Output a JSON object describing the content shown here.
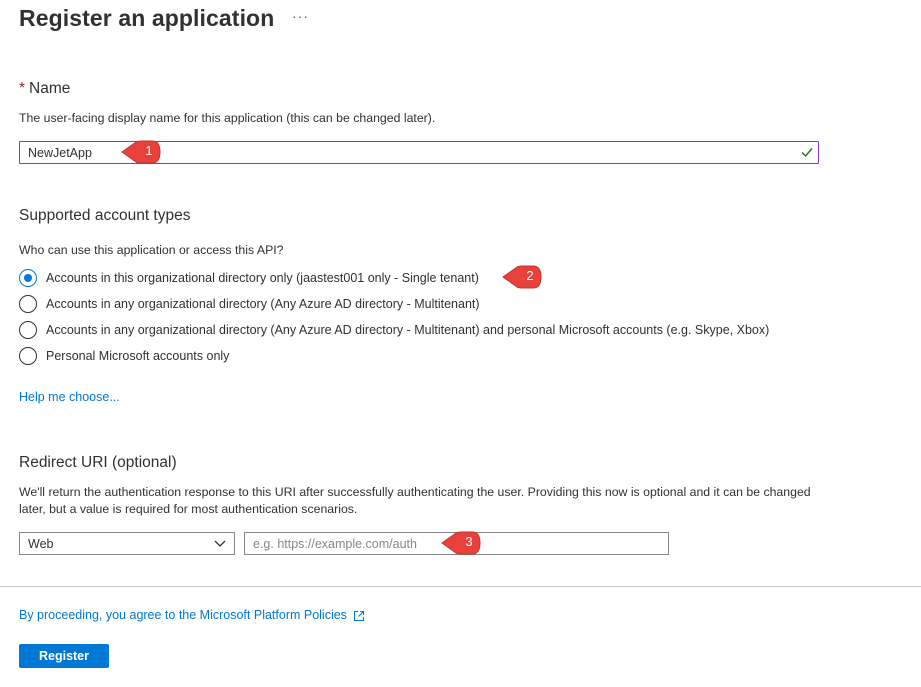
{
  "header": {
    "title": "Register an application",
    "more_label": "···"
  },
  "name_section": {
    "required_marker": "*",
    "title": "Name",
    "description": "The user-facing display name for this application (this can be changed later).",
    "input_value": "NewJetApp"
  },
  "account_types": {
    "title": "Supported account types",
    "question": "Who can use this application or access this API?",
    "options": [
      {
        "label": "Accounts in this organizational directory only (jaastest001 only - Single tenant)",
        "selected": true
      },
      {
        "label": "Accounts in any organizational directory (Any Azure AD directory - Multitenant)",
        "selected": false
      },
      {
        "label": "Accounts in any organizational directory (Any Azure AD directory - Multitenant) and personal Microsoft accounts (e.g. Skype, Xbox)",
        "selected": false
      },
      {
        "label": "Personal Microsoft accounts only",
        "selected": false
      }
    ],
    "help_link": "Help me choose..."
  },
  "redirect": {
    "title": "Redirect URI (optional)",
    "description": "We'll return the authentication response to this URI after successfully authenticating the user. Providing this now is optional and it can be changed later, but a value is required for most authentication scenarios.",
    "platform_value": "Web",
    "uri_placeholder": "e.g. https://example.com/auth",
    "uri_value": ""
  },
  "footer": {
    "policy_text": "By proceeding, you agree to the Microsoft Platform Policies",
    "register_label": "Register"
  },
  "callouts": [
    "1",
    "2",
    "3"
  ],
  "colors": {
    "accent": "#0078d4",
    "callout": "#e8413b",
    "focus_border": "#8a3ab9",
    "valid_check": "#107c10"
  }
}
